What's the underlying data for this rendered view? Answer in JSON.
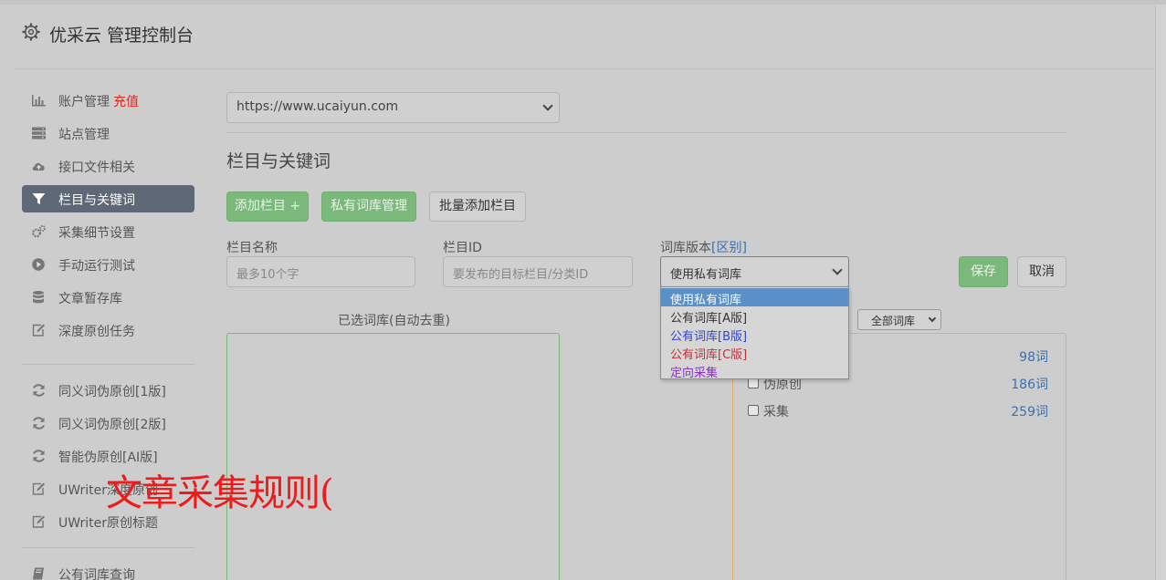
{
  "header": {
    "title": "优采云 管理控制台"
  },
  "sidebar": {
    "groups": [
      [
        {
          "label": "账户管理",
          "badge": "充值",
          "icon": "bar-chart-icon"
        },
        {
          "label": "站点管理",
          "icon": "server-icon"
        },
        {
          "label": "接口文件相关",
          "icon": "cloud-upload-icon"
        },
        {
          "label": "栏目与关键词",
          "icon": "filter-icon",
          "active": true
        },
        {
          "label": "采集细节设置",
          "icon": "gears-icon"
        },
        {
          "label": "手动运行测试",
          "icon": "play-circle-icon"
        },
        {
          "label": "文章暂存库",
          "icon": "database-icon"
        },
        {
          "label": "深度原创任务",
          "icon": "edit-icon"
        }
      ],
      [
        {
          "label": "同义词伪原创[1版]",
          "icon": "refresh-icon"
        },
        {
          "label": "同义词伪原创[2版]",
          "icon": "refresh-icon"
        },
        {
          "label": "智能伪原创[AI版]",
          "icon": "refresh-icon"
        },
        {
          "label": "UWriter深度原创",
          "icon": "edit-icon"
        },
        {
          "label": "UWriter原创标题",
          "icon": "edit-icon"
        }
      ],
      [
        {
          "label": "公有词库查询",
          "icon": "book-icon"
        }
      ]
    ]
  },
  "main": {
    "site_select": {
      "value": "https://www.ucaiyun.com"
    },
    "section_title": "栏目与关键词",
    "buttons": {
      "add_column": "添加栏目 +",
      "private_lib": "私有词库管理",
      "batch_add": "批量添加栏目"
    },
    "form": {
      "name_label": "栏目名称",
      "name_placeholder": "最多10个字",
      "id_label": "栏目ID",
      "id_placeholder": "要发布的目标栏目/分类ID",
      "version_label": "词库版本",
      "version_diff": "[区别]",
      "version_value": "使用私有词库",
      "save": "保存",
      "cancel": "取消"
    },
    "version_options": [
      {
        "label": "使用私有词库",
        "color": "#ffffff",
        "selected": true
      },
      {
        "label": "公有词库[A版]",
        "color": "#333333"
      },
      {
        "label": "公有词库[B版]",
        "color": "#3344cc"
      },
      {
        "label": "公有词库[C版]",
        "color": "#c0303a"
      },
      {
        "label": "定向采集",
        "color": "#8a2fc8"
      }
    ],
    "selected_panel_title": "已选词库(自动去重)",
    "library_filter": "全部词库",
    "libraries": [
      {
        "name": "",
        "count": "98词"
      },
      {
        "name": "伪原创",
        "count": "186词"
      },
      {
        "name": "采集",
        "count": "259词"
      }
    ]
  },
  "overlay": {
    "text": "文章采集规则("
  }
}
